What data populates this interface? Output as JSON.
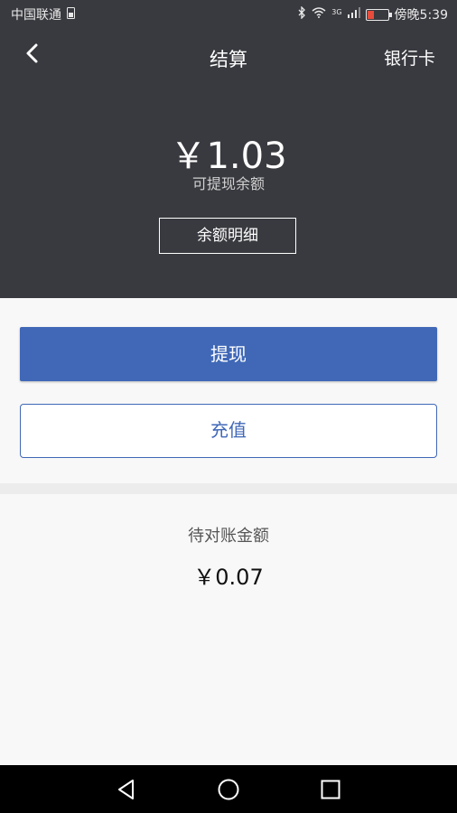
{
  "status_bar": {
    "carrier": "中国联通",
    "network": "3G",
    "time": "傍晚5:39"
  },
  "header": {
    "title": "结算",
    "right_action": "银行卡",
    "balance_amount": "￥1.03",
    "balance_label": "可提现余额",
    "detail_button": "余额明细"
  },
  "actions": {
    "withdraw_label": "提现",
    "recharge_label": "充值"
  },
  "pending": {
    "label": "待对账金额",
    "amount": "￥0.07"
  },
  "colors": {
    "header_bg": "#393a3f",
    "accent": "#4068b7"
  }
}
